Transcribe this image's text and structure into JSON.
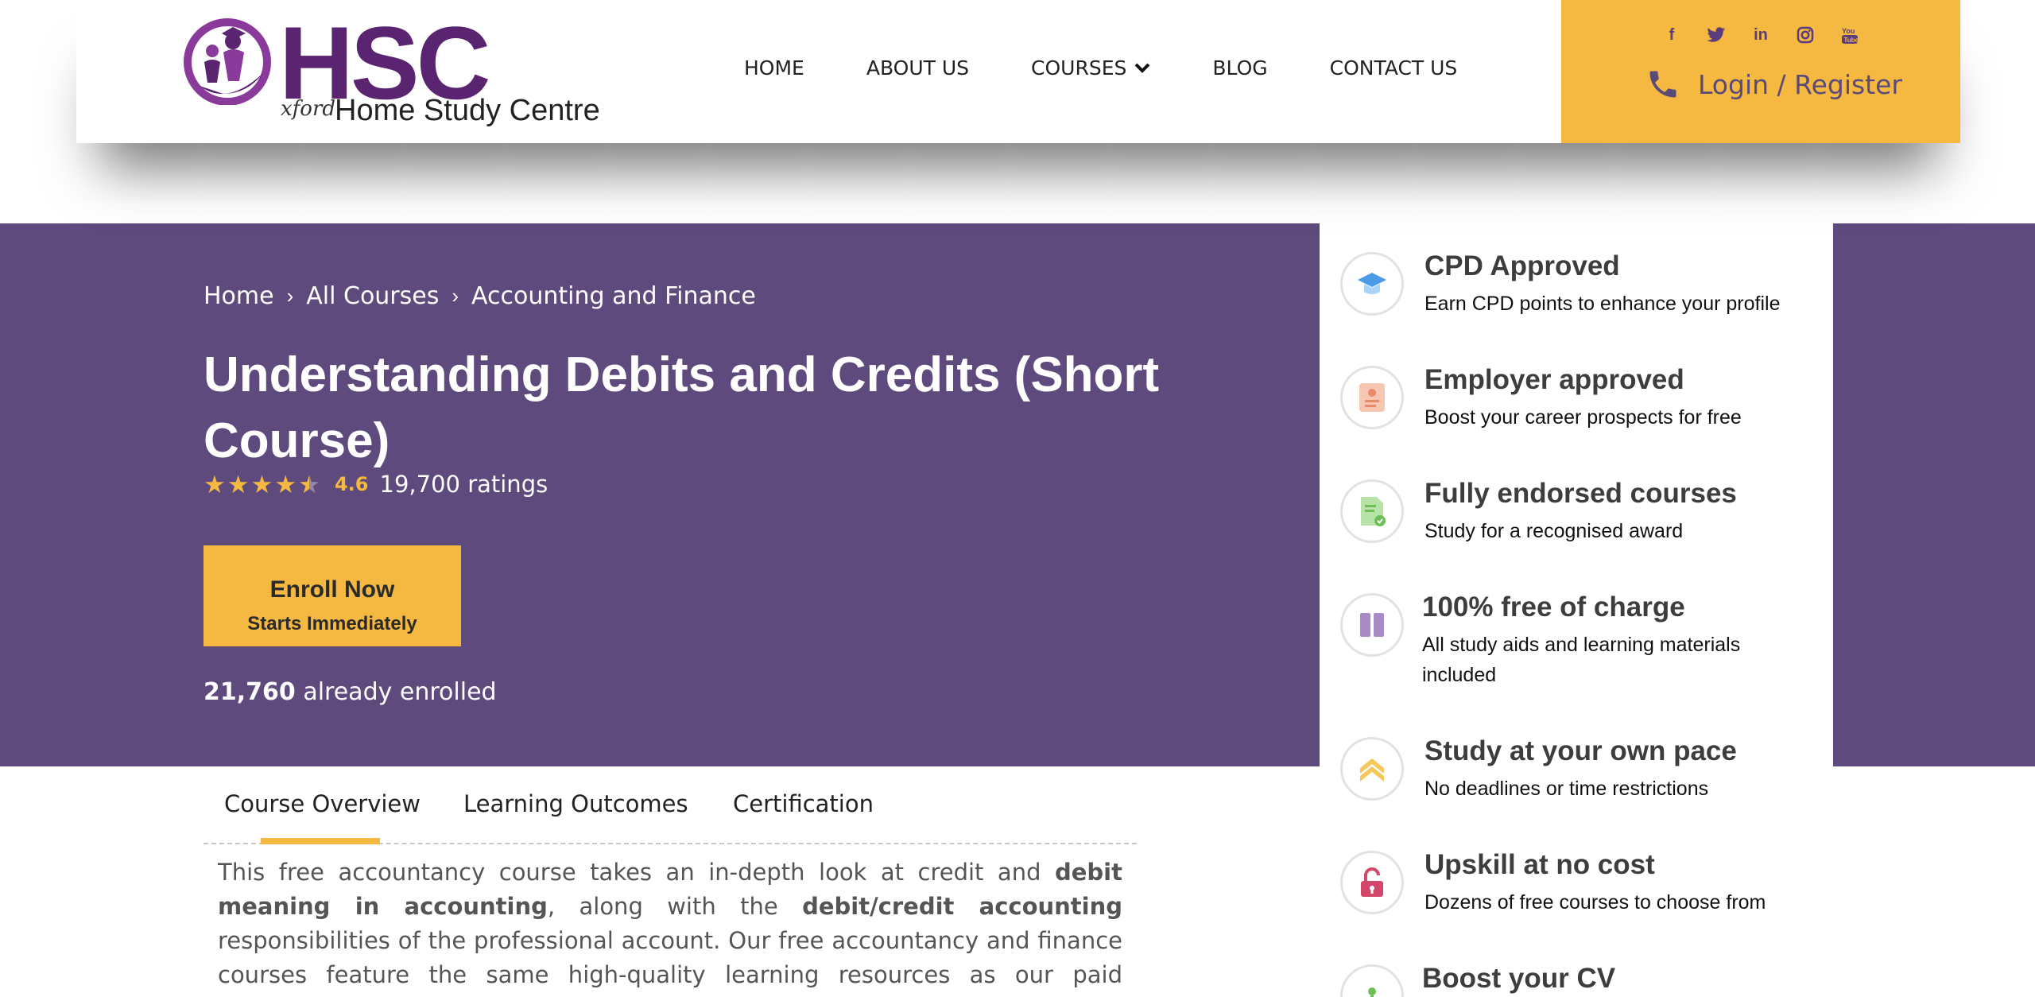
{
  "brand": {
    "logo_text": "HSC",
    "logo_prefix": "xford",
    "logo_subtitle": "Home Study Centre",
    "accent_color": "#f5b841",
    "hero_color": "#5e4a7c",
    "logo_color": "#5b2470"
  },
  "nav": {
    "home": "HOME",
    "about": "ABOUT US",
    "courses": "COURSES",
    "blog": "BLOG",
    "contact": "CONTACT US"
  },
  "socials": [
    "facebook-icon",
    "twitter-icon",
    "linkedin-icon",
    "instagram-icon",
    "youtube-icon"
  ],
  "auth": {
    "login_label": "Login / Register"
  },
  "breadcrumb": {
    "home": "Home",
    "all_courses": "All Courses",
    "category": "Accounting and Finance"
  },
  "course": {
    "title": "Understanding Debits and Credits (Short Course)",
    "rating_value": "4.6",
    "rating_count": "19,700 ratings",
    "stars": 4.5,
    "enroll_label": "Enroll Now",
    "enroll_sub": "Starts Immediately",
    "enrolled_count": "21,760",
    "enrolled_suffix": "already enrolled"
  },
  "tabs": {
    "overview": "Course Overview",
    "outcomes": "Learning Outcomes",
    "certification": "Certification",
    "active": "overview"
  },
  "overview": {
    "p1": "This free accountancy course takes an in-depth look at credit and ",
    "b1": "debit meaning in accounting",
    "p2": ", along with the ",
    "b2": "debit/credit accounting",
    "p3": " responsibilities of the professional account. Our free accountancy and finance courses feature the same high-quality learning resources as our paid programs, along with the"
  },
  "features": [
    {
      "icon": "graduation-cap-icon",
      "title": "CPD Approved",
      "desc": "Earn CPD points to enhance your profile"
    },
    {
      "icon": "id-badge-icon",
      "title": "Employer approved",
      "desc": "Boost your career prospects for free"
    },
    {
      "icon": "certificate-document-icon",
      "title": "Fully endorsed courses",
      "desc": "Study for a recognised award"
    },
    {
      "icon": "books-icon",
      "title": "100% free of charge",
      "desc": "All study aids and learning materials included"
    },
    {
      "icon": "chevrons-up-icon",
      "title": "Study at your own pace",
      "desc": "No deadlines or time restrictions"
    },
    {
      "icon": "unlock-icon",
      "title": "Upskill at no cost",
      "desc": "Dozens of free courses to choose from"
    },
    {
      "icon": "cv-icon",
      "title": "Boost your CV",
      "desc": ""
    }
  ]
}
